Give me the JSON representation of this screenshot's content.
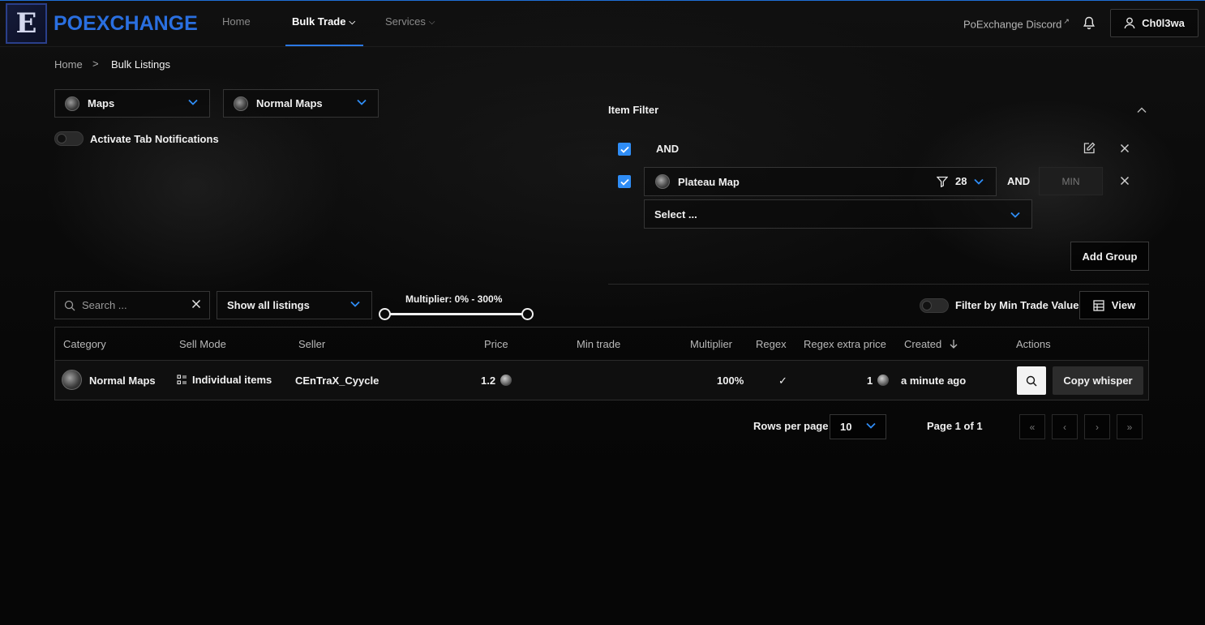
{
  "brand": {
    "logo_letter": "E",
    "name": "POEXCHANGE",
    "accent": "#2a6fe0"
  },
  "nav": {
    "home": "Home",
    "bulk_trade": "Bulk Trade",
    "services": "Services",
    "discord": "PoExchange Discord",
    "user": "Ch0l3wa"
  },
  "breadcrumb": {
    "home": "Home",
    "separator": ">",
    "current": "Bulk Listings"
  },
  "filters": {
    "category": "Maps",
    "subcategory": "Normal Maps",
    "tab_notifications_label": "Activate Tab Notifications",
    "tab_notifications_on": false
  },
  "item_filter": {
    "title": "Item Filter",
    "group_operator": "AND",
    "item_name": "Plateau Map",
    "item_count": "28",
    "item_operator": "AND",
    "min_placeholder": "MIN",
    "select_placeholder": "Select ...",
    "add_group_label": "Add Group",
    "checkbox_color": "#2f8df6"
  },
  "toolbar": {
    "search_placeholder": "Search ...",
    "listing_mode": "Show all listings",
    "multiplier_label": "Multiplier: 0% - 300%",
    "multiplier_min": 0,
    "multiplier_max": 300,
    "min_trade_label": "Filter by Min Trade Value",
    "min_trade_on": false,
    "view_label": "View"
  },
  "table": {
    "headers": [
      "Category",
      "Sell Mode",
      "Seller",
      "Price",
      "Min trade",
      "Multiplier",
      "Regex",
      "Regex extra price",
      "Created",
      "Actions"
    ],
    "rows": [
      {
        "category": "Normal Maps",
        "sell_mode": "Individual items",
        "seller": "CEnTraX_Cyycle",
        "price": "1.2",
        "min_trade": "",
        "multiplier": "100%",
        "regex": "✓",
        "regex_extra_price": "1",
        "created": "a minute ago",
        "copy_label": "Copy whisper"
      }
    ]
  },
  "pagination": {
    "rows_per_page_label": "Rows per page",
    "rows_per_page": "10",
    "page_info": "Page 1 of 1",
    "first": "«",
    "prev": "‹",
    "next": "›",
    "last": "»"
  }
}
